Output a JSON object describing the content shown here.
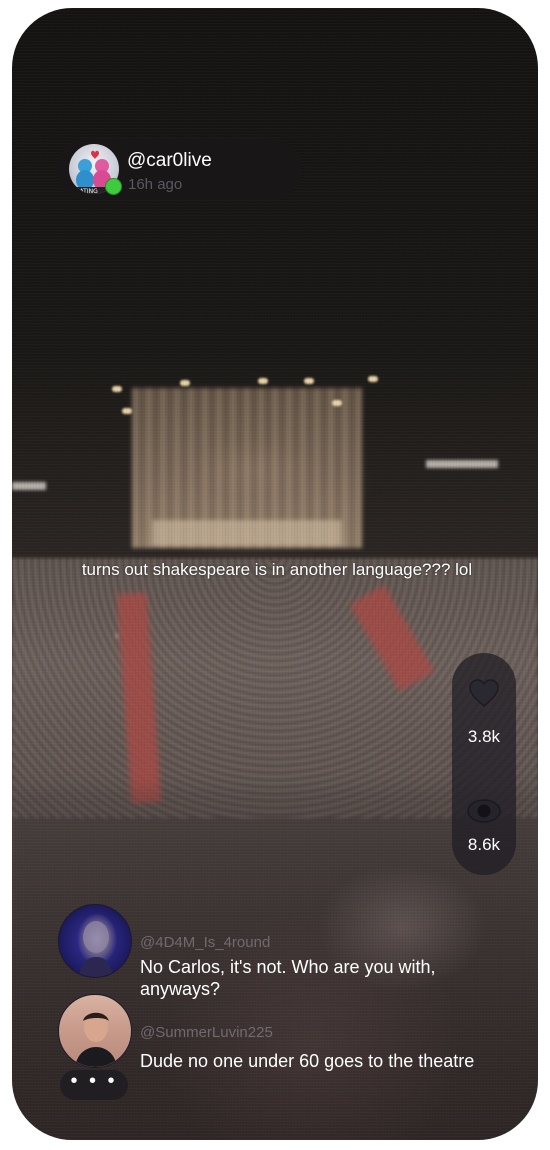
{
  "post": {
    "username": "@car0live",
    "timestamp": "16h ago",
    "avatar_icon": "dating-couple-icon",
    "online_status_color": "#3ecb3e",
    "caption": "turns out shakespeare is in another language??? lol"
  },
  "stats": {
    "likes": "3.8k",
    "likes_icon": "heart-icon",
    "views": "8.6k",
    "views_icon": "eye-icon"
  },
  "comments": [
    {
      "handle": "@4D4M_Is_4round",
      "text": "No Carlos, it's not. Who are you with, anyways?",
      "avatar_icon": "profile-photo-icon"
    },
    {
      "handle": "@SummerLuvin225",
      "text": "Dude no one under 60 goes to the theatre",
      "avatar_icon": "profile-photo-icon"
    }
  ],
  "more_comments_label": "• • •"
}
